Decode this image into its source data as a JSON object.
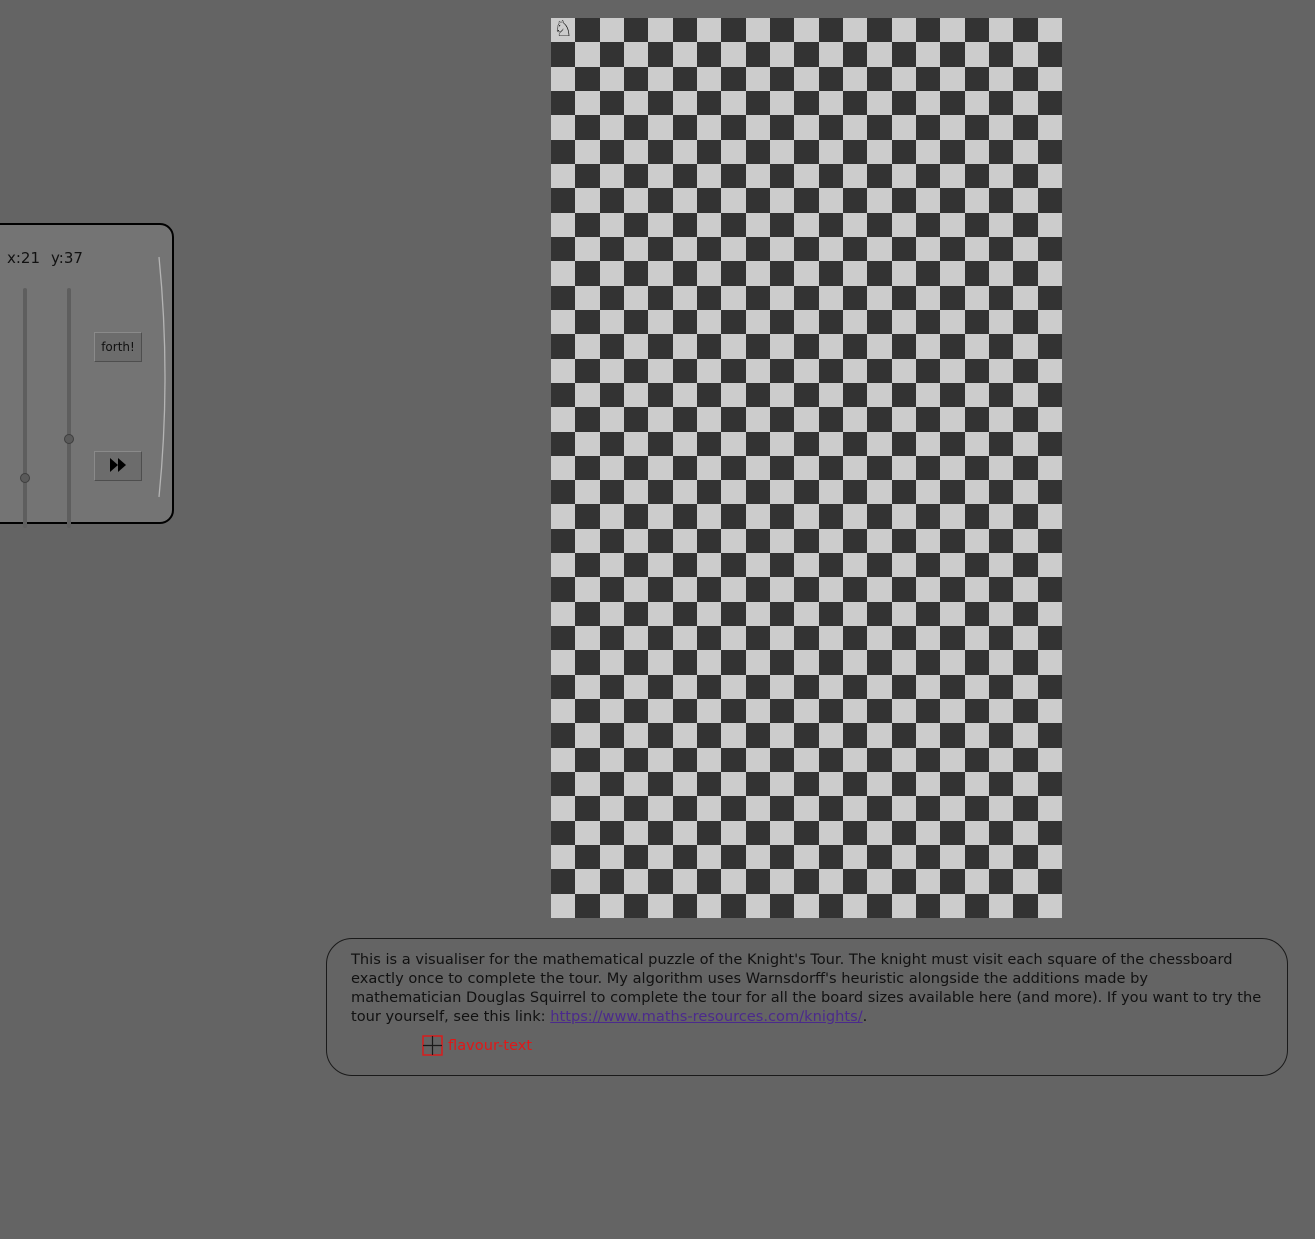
{
  "controls": {
    "x_label": "x:21",
    "y_label": "y:37",
    "x_value": 21,
    "y_value": 37,
    "forth_label": "forth!",
    "fast_forward_icon": "fast-forward-icon",
    "collapse_icon": "chevron-right-icon"
  },
  "board": {
    "columns": 21,
    "rows": 37,
    "light_color": "#cccccc",
    "dark_color": "#333333",
    "knight_glyph": "♘",
    "knight_position": {
      "col": 1,
      "row": 1
    }
  },
  "info": {
    "text": "This is a visualiser for the mathematical puzzle of the Knight's Tour. The knight must visit each square of the chessboard exactly once to complete the tour. My algorithm uses Warnsdorff's heuristic alongside the additions made by mathematician Douglas Squirrel to complete the tour for all the board sizes available here (and more). If you want to try the tour yourself, see this link: ",
    "link_text": "https://www.maths-resources.com/knights/",
    "after_link": ".",
    "flavour_text": "flavour-text"
  }
}
